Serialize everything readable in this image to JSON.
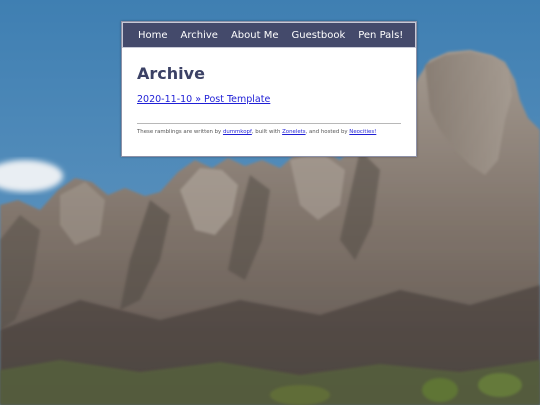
{
  "nav": {
    "items": [
      {
        "label": "Home"
      },
      {
        "label": "Archive"
      },
      {
        "label": "About Me"
      },
      {
        "label": "Guestbook"
      },
      {
        "label": "Pen Pals!"
      }
    ]
  },
  "main": {
    "title": "Archive",
    "posts": [
      {
        "label": "2020-11-10 » Post Template"
      }
    ]
  },
  "footer": {
    "text_1": "These ramblings are written by ",
    "author_link": "dummkopf",
    "text_2": ", built with ",
    "zonelets_link": "Zonelets",
    "text_3": ", and hosted by ",
    "neocities_link": "Neocities!"
  },
  "colors": {
    "nav_bg": "#444a6b",
    "title": "#3b4165",
    "link": "#1f1fd6",
    "sky": "#4a85b5",
    "rock": "#7a6f68"
  }
}
